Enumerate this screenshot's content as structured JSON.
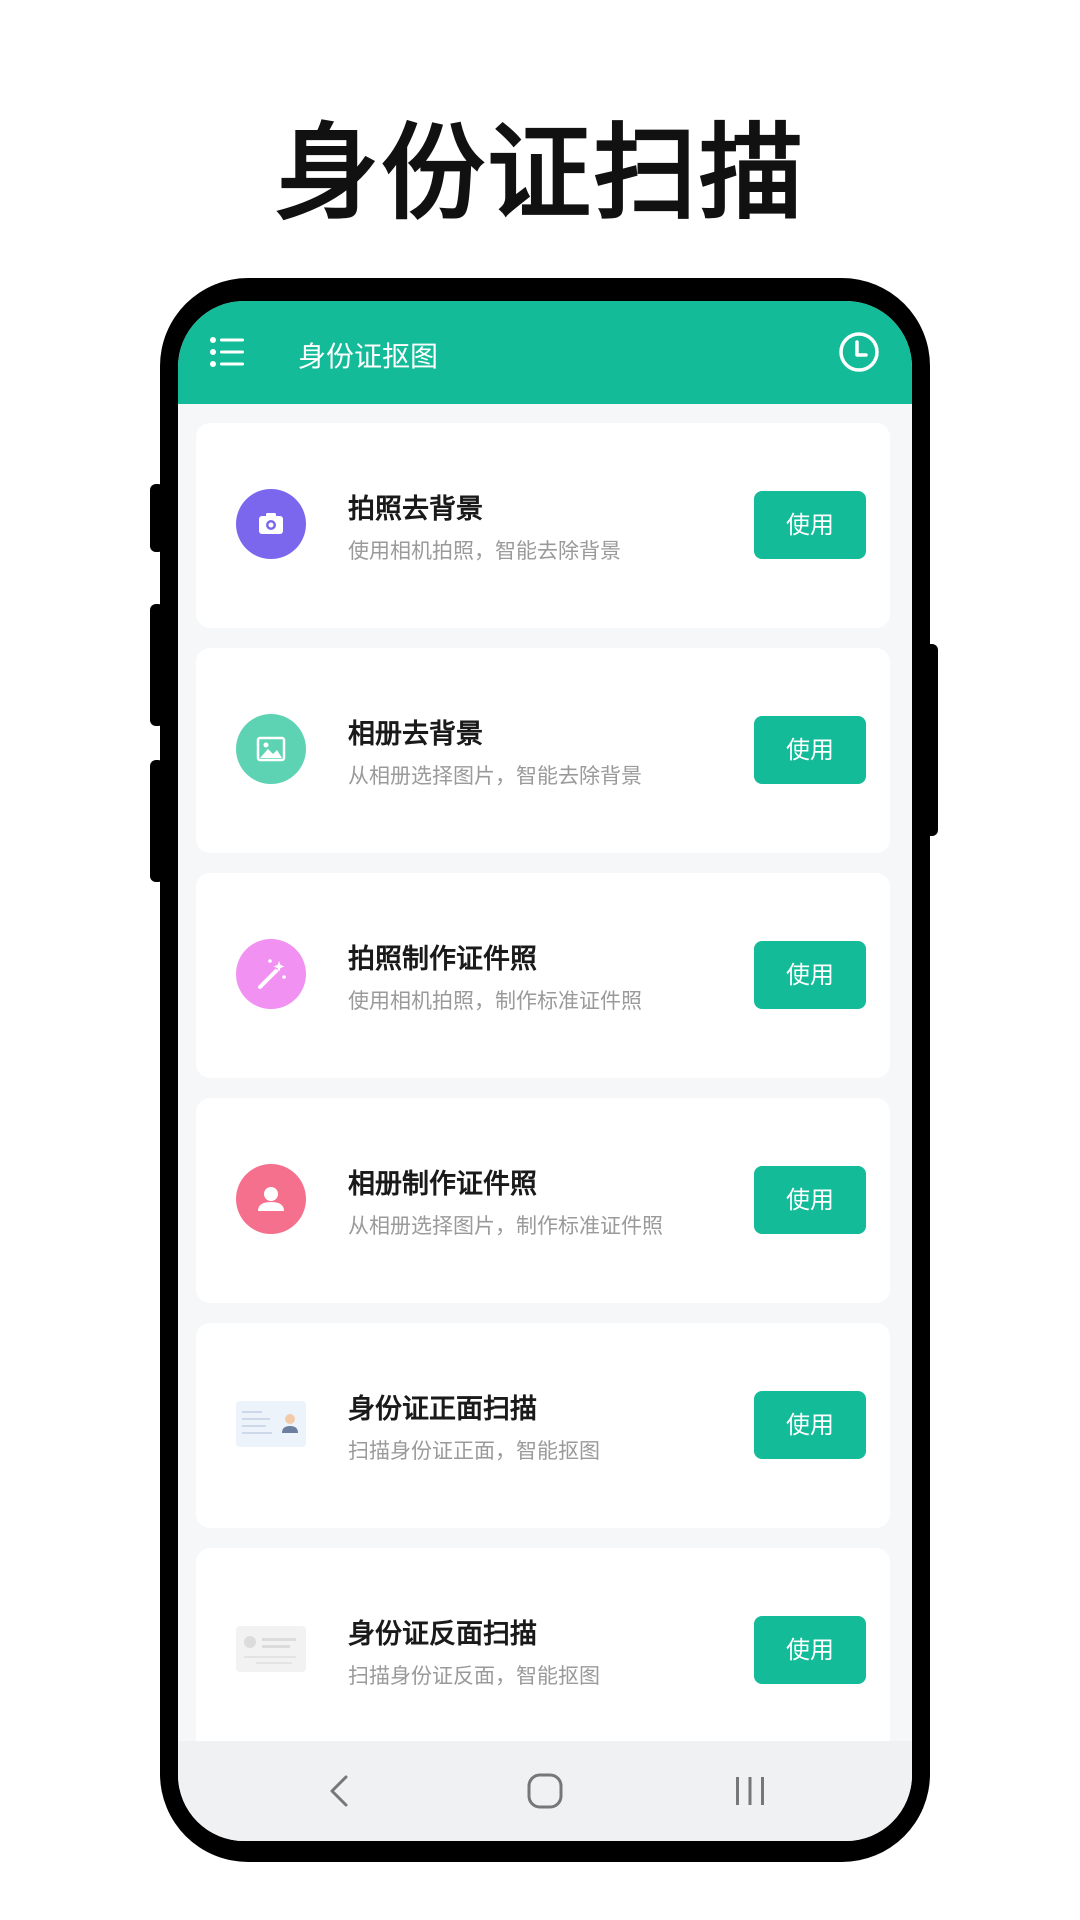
{
  "promo": {
    "title": "身份证扫描"
  },
  "appbar": {
    "title": "身份证抠图",
    "menu_icon": "menu-list-icon",
    "history_icon": "clock-icon",
    "color": "#13bb98"
  },
  "items": [
    {
      "title": "拍照去背景",
      "desc": "使用相机拍照，智能去除背景",
      "button": "使用",
      "icon": "camera-icon",
      "icon_color": "#7b67ee"
    },
    {
      "title": "相册去背景",
      "desc": "从相册选择图片，智能去除背景",
      "button": "使用",
      "icon": "image-icon",
      "icon_color": "#5dd3b3"
    },
    {
      "title": "拍照制作证件照",
      "desc": "使用相机拍照，制作标准证件照",
      "button": "使用",
      "icon": "magic-wand-icon",
      "icon_color": "#f191f2"
    },
    {
      "title": "相册制作证件照",
      "desc": "从相册选择图片，制作标准证件照",
      "button": "使用",
      "icon": "portrait-icon",
      "icon_color": "#f5708c"
    },
    {
      "title": "身份证正面扫描",
      "desc": "扫描身份证正面，智能抠图",
      "button": "使用",
      "icon": "id-card-front-icon",
      "icon_color": "#edf3fb"
    },
    {
      "title": "身份证反面扫描",
      "desc": "扫描身份证反面，智能抠图",
      "button": "使用",
      "icon": "id-card-back-icon",
      "icon_color": "#f2f2f2"
    }
  ],
  "navbar": {
    "back_icon": "back-chevron-icon",
    "home_icon": "home-icon",
    "recents_icon": "recents-icon"
  }
}
